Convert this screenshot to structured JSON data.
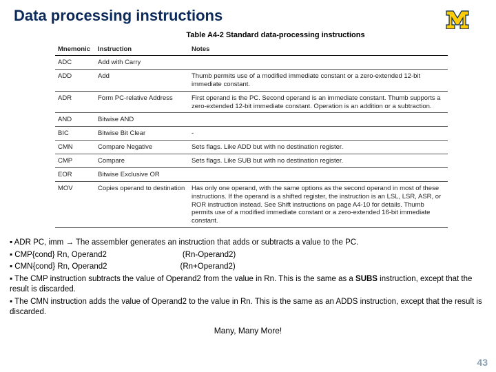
{
  "page": {
    "title": "Data processing instructions",
    "table_caption": "Table A4-2 Standard data-processing instructions",
    "page_number": "43"
  },
  "table": {
    "headers": {
      "mnemonic": "Mnemonic",
      "instruction": "Instruction",
      "notes": "Notes"
    },
    "rows": [
      {
        "mn": "ADC",
        "ins": "Add with Carry",
        "notes": ""
      },
      {
        "mn": "ADD",
        "ins": "Add",
        "notes": "Thumb permits use of a modified immediate constant or a zero-extended 12-bit immediate constant."
      },
      {
        "mn": "ADR",
        "ins": "Form PC-relative Address",
        "notes": "First operand is the PC. Second operand is an immediate constant. Thumb supports a zero-extended 12-bit immediate constant. Operation is an addition or a subtraction."
      },
      {
        "mn": "AND",
        "ins": "Bitwise AND",
        "notes": ""
      },
      {
        "mn": "BIC",
        "ins": "Bitwise Bit Clear",
        "notes": "-"
      },
      {
        "mn": "CMN",
        "ins": "Compare Negative",
        "notes": "Sets flags. Like ADD but with no destination register."
      },
      {
        "mn": "CMP",
        "ins": "Compare",
        "notes": "Sets flags. Like SUB but with no destination register."
      },
      {
        "mn": "EOR",
        "ins": "Bitwise Exclusive OR",
        "notes": ""
      },
      {
        "mn": "MOV",
        "ins": "Copies operand to destination",
        "notes": "Has only one operand, with the same options as the second operand in most of these instructions. If the operand is a shifted register, the instruction is an LSL, LSR, ASR, or ROR instruction instead. See Shift instructions on page A4-10 for details. Thumb permits use of a modified immediate constant or a zero-extended 16-bit immediate constant."
      }
    ]
  },
  "bullets": {
    "b1a": "▪ ADR PC, imm → The assembler generates an instruction that adds or subtracts a value to the PC.",
    "b2a": "▪ CMP{cond} Rn, Operand2",
    "b2b": "(Rn-Operand2)",
    "b3a": "▪ CMN{cond} Rn, Operand2",
    "b3b": "(Rn+Operand2)",
    "b4a": "▪ The CMP instruction subtracts the value of Operand2 from the value in Rn. This is the same as a ",
    "b4b": "SUBS",
    "b4c": " instruction, except that the result is discarded.",
    "b5": "▪ The CMN instruction adds the value of Operand2 to the value in Rn. This is the same as an ADDS instruction, except that the result is discarded.",
    "many": "Many, Many More!"
  }
}
